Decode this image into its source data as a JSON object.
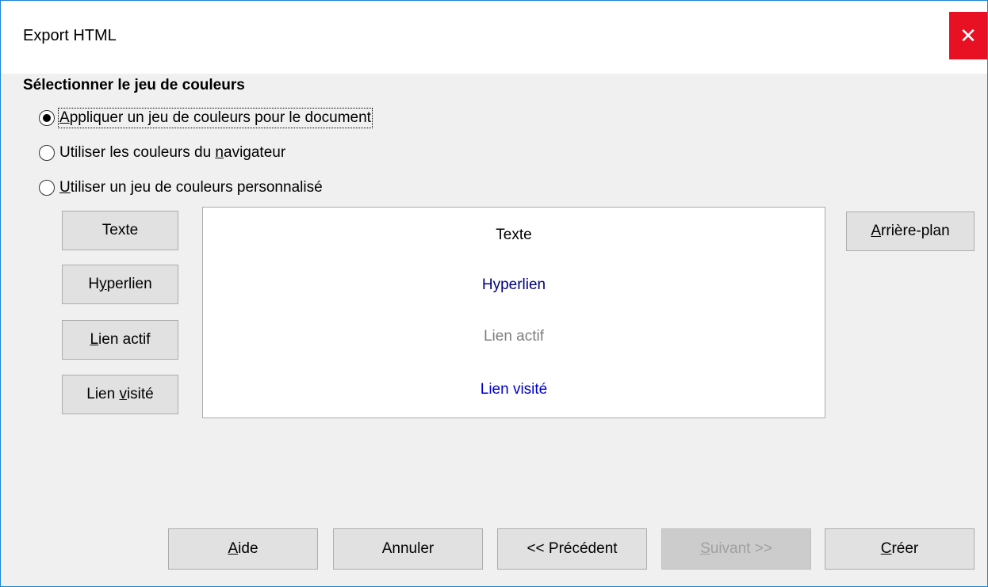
{
  "window": {
    "title": "Export HTML",
    "close_symbol": "✕"
  },
  "section": {
    "heading": "Sélectionner le jeu de couleurs"
  },
  "options": [
    {
      "label": "Appliquer un jeu de couleurs pour le document",
      "mnemonic": "A",
      "checked": true
    },
    {
      "label_pre": "Utiliser les couleurs du ",
      "mnemonic": "n",
      "label_post": "avigateur",
      "checked": false
    },
    {
      "mnemonic": "U",
      "label_post": "tiliser un jeu de couleurs personnalisé",
      "checked": false
    }
  ],
  "color_buttons": {
    "text": "Texte",
    "hyperlink_pre": "H",
    "hyperlink_mn": "y",
    "hyperlink_post": "perlien",
    "active_mn": "L",
    "active_post": "ien actif",
    "visited_pre": "Lien ",
    "visited_mn": "v",
    "visited_post": "isité",
    "background_mn": "A",
    "background_post": "rrière-plan"
  },
  "preview": {
    "text": "Texte",
    "hyperlink": "Hyperlien",
    "active_link": "Lien actif",
    "visited_link": "Lien visité",
    "colors": {
      "text": "#000000",
      "hyperlink": "#000080",
      "active_link": "#808080",
      "visited_link": "#0000cc",
      "background": "#ffffff"
    }
  },
  "footer": {
    "help_mn": "A",
    "help_post": "ide",
    "cancel": "Annuler",
    "previous": "<< Précédent",
    "next_mn": "S",
    "next_post": "uivant >>",
    "create_mn": "C",
    "create_post": "réer"
  }
}
